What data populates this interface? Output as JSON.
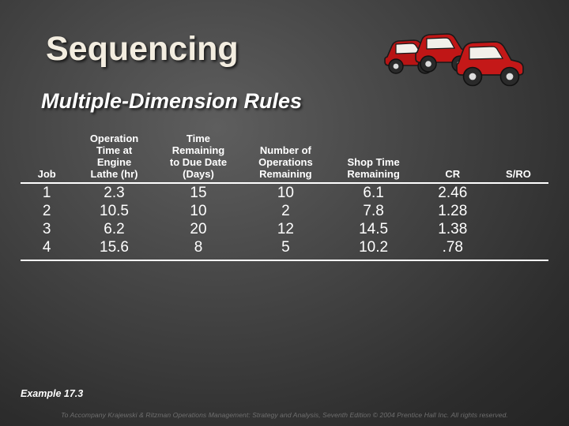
{
  "slide": {
    "title": "Sequencing",
    "subtitle": "Multiple-Dimension Rules",
    "example_label": "Example 17.3",
    "credit": "To Accompany Krajewski & Ritzman Operations Management: Strategy and Analysis, Seventh Edition © 2004 Prentice Hall Inc. All rights reserved.",
    "clipart_name": "red-antique-cars-clipart"
  },
  "table": {
    "headers": [
      "Job",
      "Operation Time at Engine Lathe (hr)",
      "Time Remaining to Due Date (Days)",
      "Number of Operations Remaining",
      "Shop Time Remaining",
      "CR",
      "S/RO"
    ],
    "header_lines": [
      [
        "Job"
      ],
      [
        "Operation",
        "Time at",
        "Engine",
        "Lathe (hr)"
      ],
      [
        "Time",
        "Remaining",
        "to Due Date",
        "(Days)"
      ],
      [
        "Number of",
        "Operations",
        "Remaining"
      ],
      [
        "Shop Time",
        "Remaining"
      ],
      [
        "CR"
      ],
      [
        "S/RO"
      ]
    ],
    "rows": [
      {
        "job": "1",
        "op_time": "2.3",
        "time_remaining": "15",
        "num_ops": "10",
        "shop_time": "6.1",
        "cr": "2.46",
        "sro": ""
      },
      {
        "job": "2",
        "op_time": "10.5",
        "time_remaining": "10",
        "num_ops": "2",
        "shop_time": "7.8",
        "cr": "1.28",
        "sro": ""
      },
      {
        "job": "3",
        "op_time": "6.2",
        "time_remaining": "20",
        "num_ops": "12",
        "shop_time": "14.5",
        "cr": "1.38",
        "sro": ""
      },
      {
        "job": "4",
        "op_time": "15.6",
        "time_remaining": "8",
        "num_ops": "5",
        "shop_time": "10.2",
        "cr": ".78",
        "sro": ""
      }
    ]
  }
}
